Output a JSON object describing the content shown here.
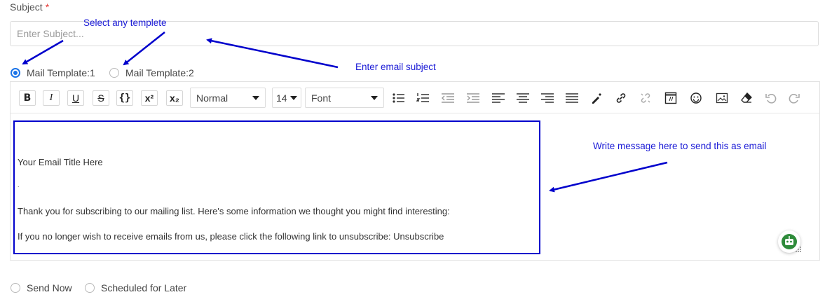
{
  "subject": {
    "label": "Subject",
    "required_mark": "*",
    "placeholder": "Enter Subject..."
  },
  "templates": [
    {
      "label": "Mail Template:1",
      "checked": true
    },
    {
      "label": "Mail Template:2",
      "checked": false
    }
  ],
  "toolbar": {
    "bold": "B",
    "italic": "I",
    "underline": "U",
    "strike": "S",
    "code": "{}",
    "superscript": "x²",
    "subscript": "x₂",
    "heading": "Normal",
    "size": "14",
    "font": "Font"
  },
  "content": {
    "title": "Your Email Title Here",
    "dot": ".",
    "line1": "Thank you for subscribing to our mailing list. Here's some information we thought you might find interesting:",
    "line2": "If you no longer wish to receive emails from us, please click the following link to unsubscribe: Unsubscribe"
  },
  "annotations": {
    "select_template": "Select any templete",
    "enter_subject": "Enter email subject",
    "write_message": "Write message here to send this as email"
  },
  "send_options": [
    {
      "label": "Send Now",
      "checked": false
    },
    {
      "label": "Scheduled for Later",
      "checked": false
    }
  ],
  "colors": {
    "annotation": "#0000cc",
    "accent": "#1a73e8",
    "required": "#e53935",
    "bot": "#2e8b3a"
  }
}
